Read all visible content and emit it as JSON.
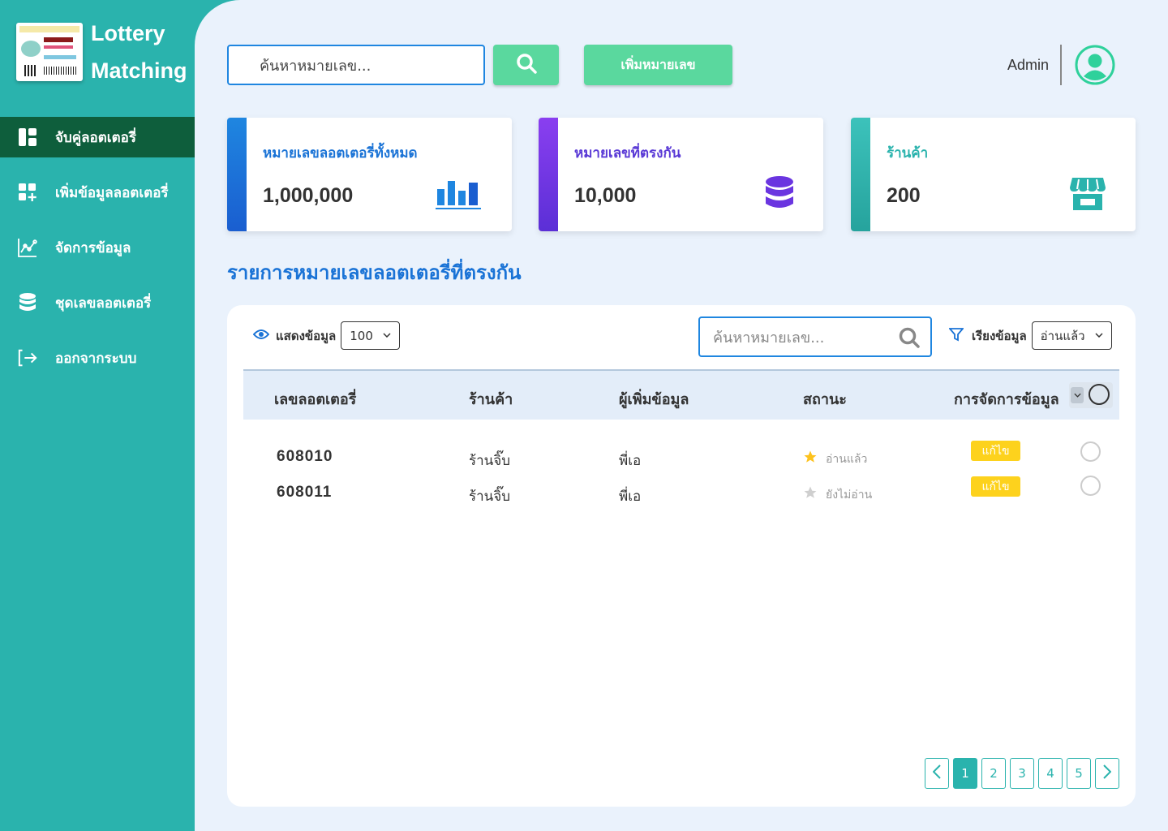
{
  "brand": {
    "line1": "Lottery",
    "line2": "Matching"
  },
  "sidebar": {
    "items": [
      {
        "label": "จับคู่ลอตเตอรี่",
        "icon": "dashboard-icon",
        "active": true
      },
      {
        "label": "เพิ่มข้อมูลลอตเตอรี่",
        "icon": "add-grid-icon"
      },
      {
        "label": "จัดการข้อมูล",
        "icon": "chart-line-icon"
      },
      {
        "label": "ชุดเลขลอตเตอรี่",
        "icon": "database-icon"
      },
      {
        "label": "ออกจากระบบ",
        "icon": "logout-icon"
      }
    ]
  },
  "header": {
    "search_placeholder": "ค้นหาหมายเลข...",
    "add_button": "เพิ่มหมายเลข",
    "user_name": "Admin"
  },
  "cards": [
    {
      "label": "หมายเลขลอตเตอรี่ทั้งหมด",
      "value": "1,000,000",
      "color": "#1f86e0",
      "icon": "bar-chart-icon"
    },
    {
      "label": "หมายเลขที่ตรงกัน",
      "value": "10,000",
      "color": "#7a3ae6",
      "icon": "database-icon"
    },
    {
      "label": "ร้านค้า",
      "value": "200",
      "color": "#2ab3ad",
      "icon": "store-icon"
    }
  ],
  "section_title": "รายการหมายเลขลอตเตอรี่ที่ตรงกัน",
  "table": {
    "show_label": "แสดงข้อมูล",
    "show_count": "100",
    "search_placeholder": "ค้นหาหมายเลข...",
    "sort_label": "เรียงข้อมูล",
    "sort_value": "อ่านแล้ว",
    "columns": [
      "เลขลอตเตอรี่",
      "ร้านค้า",
      "ผู้เพิ่มข้อมูล",
      "สถานะ",
      "การจัดการข้อมูล"
    ],
    "rows": [
      {
        "number": "608010",
        "shop": "ร้านจิ๊บ",
        "user": "พี่เอ",
        "status": "อ่านแล้ว",
        "starred": true,
        "edit": "แก้ไข"
      },
      {
        "number": "608011",
        "shop": "ร้านจิ๊บ",
        "user": "พี่เอ",
        "status": "ยังไม่อ่าน",
        "starred": false,
        "edit": "แก้ไข"
      }
    ]
  },
  "pagination": {
    "pages": [
      "1",
      "2",
      "3",
      "4",
      "5"
    ],
    "current": "1"
  },
  "colors": {
    "sidebar": "#2ab3ad",
    "active_nav": "#0e5e3c",
    "button": "#5ad89e",
    "title": "#1a73d6",
    "edit": "#fdd21d",
    "star": "#fdc21d"
  }
}
